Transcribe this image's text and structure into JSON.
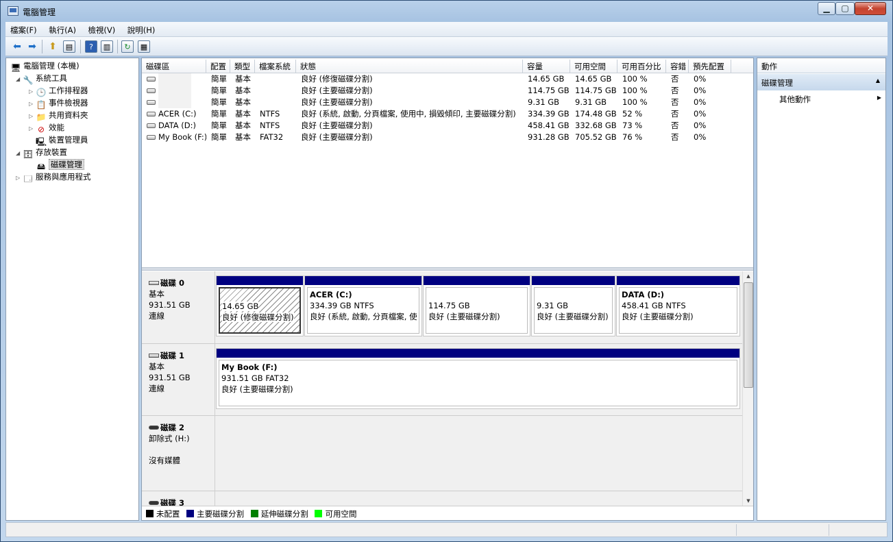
{
  "window": {
    "title": "電腦管理",
    "min": "▁",
    "max": "▢",
    "close": "✕"
  },
  "menu": [
    "檔案(F)",
    "執行(A)",
    "檢視(V)",
    "說明(H)"
  ],
  "tree": {
    "root": "電腦管理 (本機)",
    "system_tools": "系統工具",
    "task_scheduler": "工作排程器",
    "event_viewer": "事件檢視器",
    "shared_folders": "共用資料夾",
    "performance": "效能",
    "device_manager": "裝置管理員",
    "storage": "存放裝置",
    "disk_management": "磁碟管理",
    "services_apps": "服務與應用程式"
  },
  "volume_table": {
    "headers": [
      "磁碟區",
      "配置",
      "類型",
      "檔案系統",
      "狀態",
      "容量",
      "可用空間",
      "可用百分比",
      "容錯",
      "預先配置"
    ],
    "rows": [
      {
        "name": "",
        "layout": "簡單",
        "type": "基本",
        "fs": "",
        "status": "良好 (修復磁碟分割)",
        "capacity": "14.65 GB",
        "free": "14.65 GB",
        "pct": "100 %",
        "ft": "否",
        "overhead": "0%"
      },
      {
        "name": "",
        "layout": "簡單",
        "type": "基本",
        "fs": "",
        "status": "良好 (主要磁碟分割)",
        "capacity": "114.75 GB",
        "free": "114.75 GB",
        "pct": "100 %",
        "ft": "否",
        "overhead": "0%"
      },
      {
        "name": "",
        "layout": "簡單",
        "type": "基本",
        "fs": "",
        "status": "良好 (主要磁碟分割)",
        "capacity": "9.31 GB",
        "free": "9.31 GB",
        "pct": "100 %",
        "ft": "否",
        "overhead": "0%"
      },
      {
        "name": "ACER (C:)",
        "layout": "簡單",
        "type": "基本",
        "fs": "NTFS",
        "status": "良好 (系統, 啟動, 分頁檔案, 使用中, 損毀傾印, 主要磁碟分割)",
        "capacity": "334.39 GB",
        "free": "174.48 GB",
        "pct": "52 %",
        "ft": "否",
        "overhead": "0%"
      },
      {
        "name": "DATA (D:)",
        "layout": "簡單",
        "type": "基本",
        "fs": "NTFS",
        "status": "良好 (主要磁碟分割)",
        "capacity": "458.41 GB",
        "free": "332.68 GB",
        "pct": "73 %",
        "ft": "否",
        "overhead": "0%"
      },
      {
        "name": "My Book (F:)",
        "layout": "簡單",
        "type": "基本",
        "fs": "FAT32",
        "status": "良好 (主要磁碟分割)",
        "capacity": "931.28 GB",
        "free": "705.52 GB",
        "pct": "76 %",
        "ft": "否",
        "overhead": "0%"
      }
    ]
  },
  "disks": {
    "d0": {
      "name": "磁碟 0",
      "type": "基本",
      "size": "931.51 GB",
      "state": "連線",
      "parts": [
        {
          "title": "",
          "size": "14.65 GB",
          "status": "良好 (修復磁碟分割)"
        },
        {
          "title": "ACER  (C:)",
          "size": "334.39 GB NTFS",
          "status": "良好 (系統, 啟動, 分頁檔案, 使"
        },
        {
          "title": "",
          "size": "114.75 GB",
          "status": "良好 (主要磁碟分割)"
        },
        {
          "title": "",
          "size": "9.31 GB",
          "status": "良好 (主要磁碟分割)"
        },
        {
          "title": "DATA  (D:)",
          "size": "458.41 GB NTFS",
          "status": "良好 (主要磁碟分割)"
        }
      ]
    },
    "d1": {
      "name": "磁碟 1",
      "type": "基本",
      "size": "931.51 GB",
      "state": "連線",
      "part": {
        "title": "My Book  (F:)",
        "size": "931.51 GB FAT32",
        "status": "良好 (主要磁碟分割)"
      }
    },
    "d2": {
      "name": "磁碟 2",
      "type": "卸除式 (H:)",
      "state": "沒有媒體"
    },
    "d3": {
      "name": "磁碟 3"
    }
  },
  "legend": [
    {
      "label": "未配置",
      "color": "#000000"
    },
    {
      "label": "主要磁碟分割",
      "color": "#000080"
    },
    {
      "label": "延伸磁碟分割",
      "color": "#008000"
    },
    {
      "label": "可用空間",
      "color": "#00ff00"
    }
  ],
  "actions": {
    "title": "動作",
    "section": "磁碟管理",
    "more": "其他動作"
  }
}
